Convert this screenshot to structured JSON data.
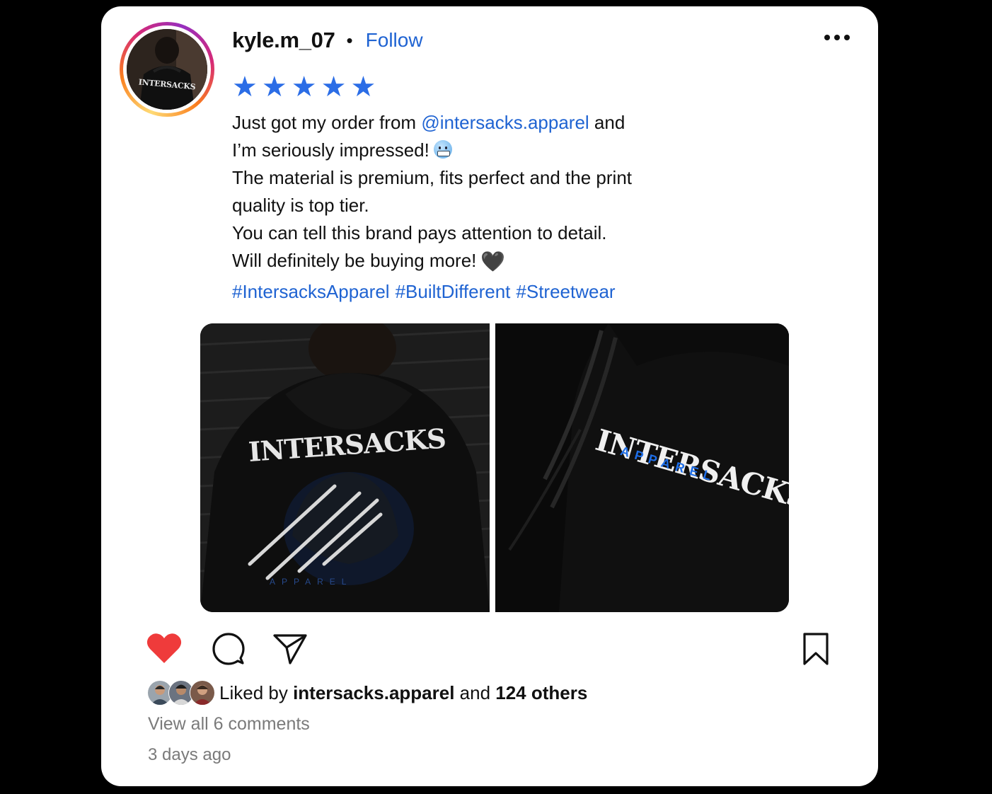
{
  "post": {
    "username": "kyle.m_07",
    "separator": "•",
    "follow_label": "Follow",
    "rating": 5,
    "stars": [
      "★",
      "★",
      "★",
      "★",
      "★"
    ],
    "avatar_text": "INTERSACKS",
    "caption": {
      "line1_pre": "Just got my order from ",
      "line1_mention": "@intersacks.apparel",
      "line1_post": " and",
      "line2": "I’m seriously impressed!",
      "line3": "The material is premium, fits perfect and the print",
      "line4": "quality is top tier.",
      "line5": "You can tell this brand pays attention to detail.",
      "line6": "Will definitely be buying more!",
      "heart_emoji": "🖤"
    },
    "hashtags": [
      "#IntersacksApparel",
      "#BuiltDifferent",
      "#Streetwear"
    ],
    "images": [
      {
        "brand": "INTERSACKS",
        "sub": "APPAREL"
      },
      {
        "brand": "INTERSACKS",
        "sub": "APPAREL"
      }
    ],
    "likes": {
      "prefix": "Liked by ",
      "user": "intersacks.apparel",
      "middle": " and ",
      "others": "124 others"
    },
    "view_comments": "View all 6 comments",
    "timestamp": "3 days ago"
  },
  "icons": [
    "more-icon",
    "heart-icon",
    "comment-icon",
    "share-icon",
    "bookmark-icon"
  ],
  "colors": {
    "accent": "#1f63d2",
    "star": "#2b6de6",
    "heart": "#ef3b3b",
    "muted": "#7a7a7a"
  }
}
